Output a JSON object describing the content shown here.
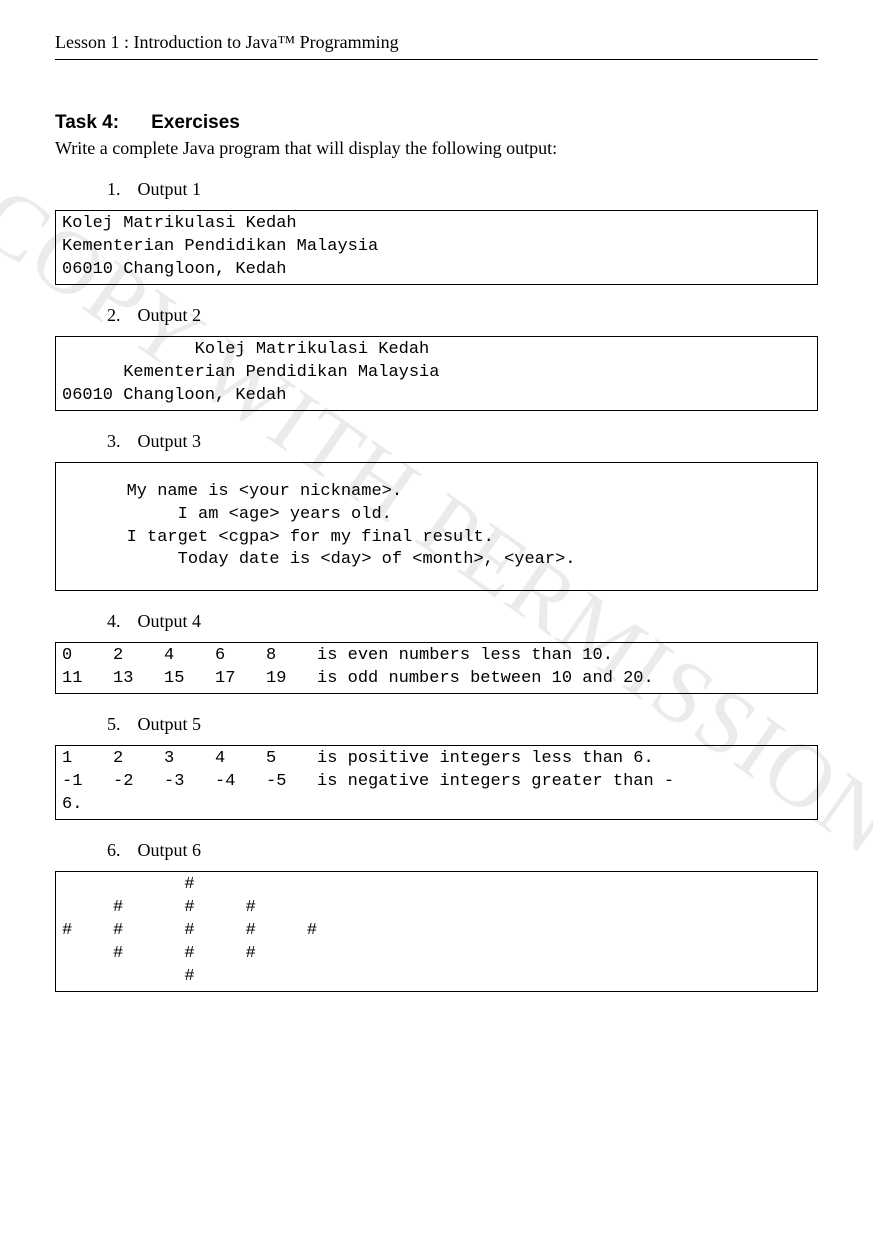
{
  "header": "Lesson 1 : Introduction to Java™ Programming",
  "watermark": "COPY WITH PERMISSION",
  "task": {
    "label": "Task 4:",
    "title": "Exercises"
  },
  "instruction": "Write a complete Java program that will display the following output:",
  "items": [
    {
      "num": "1.",
      "label": "Output 1"
    },
    {
      "num": "2.",
      "label": "Output 2"
    },
    {
      "num": "3.",
      "label": "Output 3"
    },
    {
      "num": "4.",
      "label": "Output 4"
    },
    {
      "num": "5.",
      "label": "Output 5"
    },
    {
      "num": "6.",
      "label": "Output 6"
    }
  ],
  "outputs": {
    "o1": "Kolej Matrikulasi Kedah\nKementerian Pendidikan Malaysia\n06010 Changloon, Kedah",
    "o2": "             Kolej Matrikulasi Kedah\n      Kementerian Pendidikan Malaysia\n06010 Changloon, Kedah",
    "o3": "   My name is <your nickname>.\n        I am <age> years old.\n   I target <cgpa> for my final result.\n        Today date is <day> of <month>, <year>.",
    "o4": "0    2    4    6    8    is even numbers less than 10.\n11   13   15   17   19   is odd numbers between 10 and 20.",
    "o5": "1    2    3    4    5    is positive integers less than 6.\n-1   -2   -3   -4   -5   is negative integers greater than -\n6.",
    "o6": "            #\n     #      #     #\n#    #      #     #     #\n     #      #     #\n            #"
  }
}
